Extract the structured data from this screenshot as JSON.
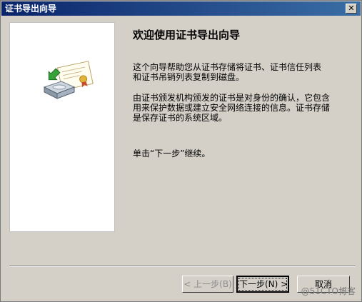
{
  "window": {
    "title": "证书导出向导",
    "close_glyph": "✕"
  },
  "content": {
    "heading": "欢迎使用证书导出向导",
    "paragraph1": "这个向导帮助您从证书存储将证书、证书信任列表\n和证书吊销列表复制到磁盘。",
    "paragraph2": "由证书颁发机构颁发的证书是对身份的确认，它包含\n用来保护数据或建立安全网络连接的信息。证书存储\n是保存证书的系统区域。",
    "paragraph3": "单击“下一步”继续。"
  },
  "buttons": {
    "back": "< 上一步(B)",
    "next": "下一步(N) >",
    "cancel": "取消"
  },
  "watermark": "@51CTO博客",
  "icon": "certificate-disk-icon"
}
